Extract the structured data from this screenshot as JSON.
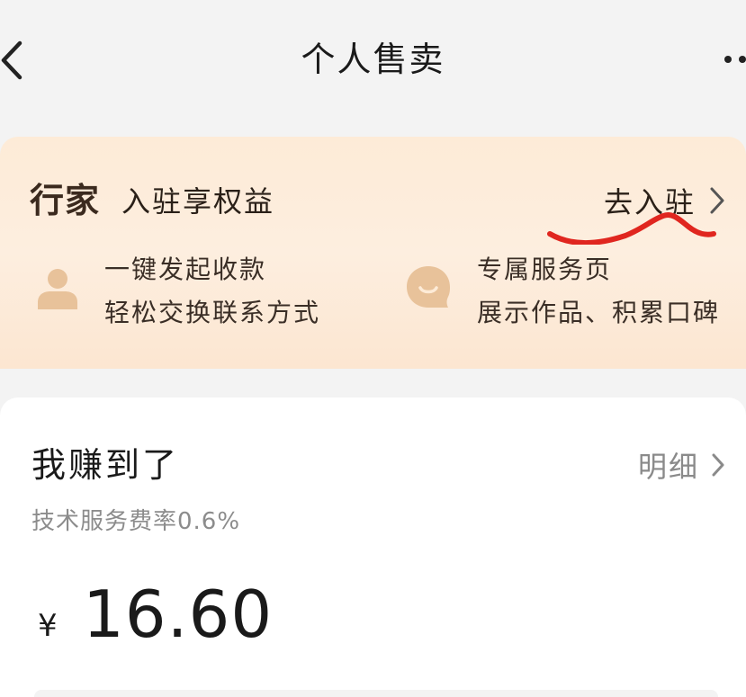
{
  "navbar": {
    "title": "个人售卖",
    "back_icon": "chevron-left-icon",
    "more_icon": "more-dots-icon"
  },
  "promo": {
    "brand": "行家",
    "title": "入驻享权益",
    "join_label": "去入驻",
    "benefits": [
      {
        "icon": "user-icon",
        "line1": "一键发起收款",
        "line2": "轻松交换联系方式"
      },
      {
        "icon": "chat-bubble-icon",
        "line1": "专属服务页",
        "line2": "展示作品、积累口碑"
      }
    ],
    "colors": {
      "background": "#fdebd7",
      "icon": "#e8c29a",
      "annotation": "#e0261f"
    }
  },
  "earnings": {
    "title": "我赚到了",
    "detail_label": "明细",
    "fee_note": "技术服务费率0.6%",
    "currency": "¥",
    "amount": "16.60"
  }
}
